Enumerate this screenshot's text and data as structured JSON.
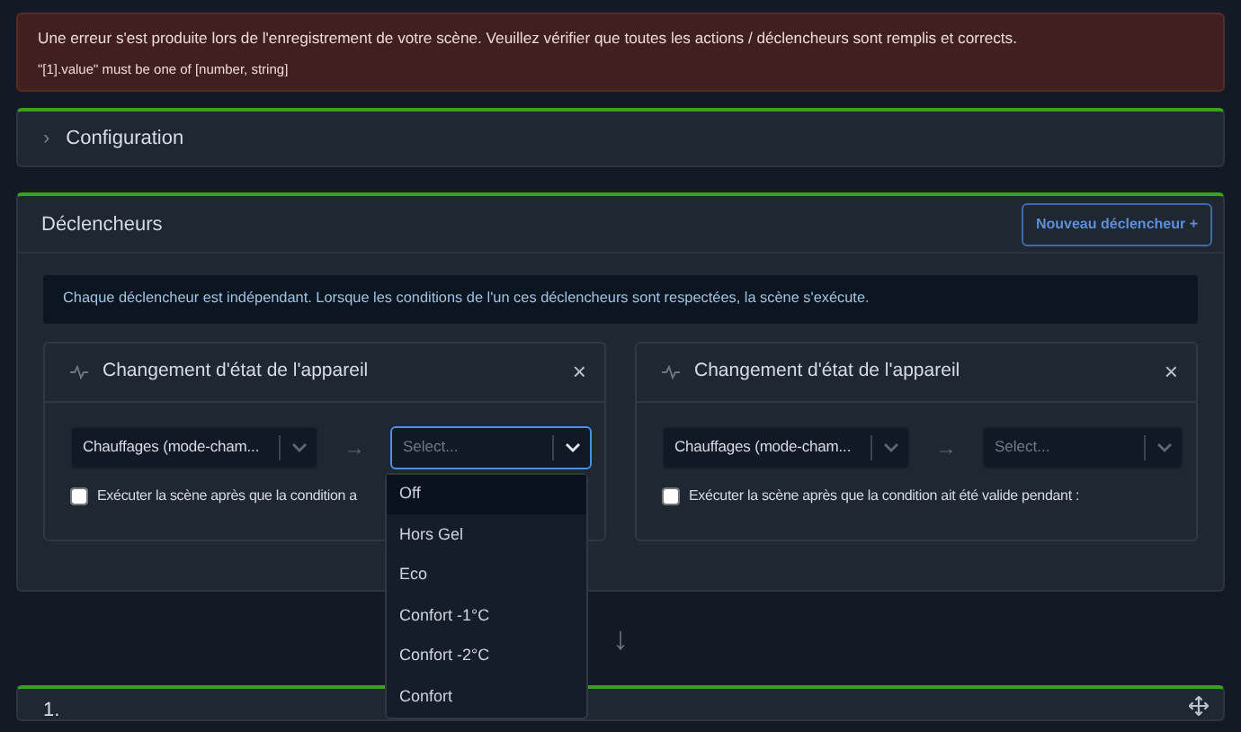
{
  "error": {
    "message": "Une erreur s'est produite lors de l'enregistrement de votre scène. Veuillez vérifier que toutes les actions / déclencheurs sont remplis et corrects.",
    "detail": "\"[1].value\" must be one of [number, string]"
  },
  "configuration": {
    "title": "Configuration",
    "chevron": "›"
  },
  "triggers_section": {
    "title": "Déclencheurs",
    "new_button": "Nouveau déclencheur +",
    "info": "Chaque déclencheur est indépendant. Lorsque les conditions de l'un ces déclencheurs sont respectées, la scène s'exécute.",
    "triggers": [
      {
        "title": "Changement d'état de l'appareil",
        "close": "×",
        "device": "Chauffages (mode-cham...",
        "arrow": "→",
        "state_placeholder": "Select...",
        "focused": true,
        "delay_checked": false,
        "delay_label": "Exécuter la scène après que la condition a",
        "options": [
          {
            "label": "Off",
            "selected": true
          },
          {
            "label": "Hors Gel",
            "selected": false
          },
          {
            "label": "Eco",
            "selected": false
          },
          {
            "label": "Confort -1°C",
            "selected": false
          },
          {
            "label": "Confort -2°C",
            "selected": false
          },
          {
            "label": "Confort",
            "selected": false
          }
        ]
      },
      {
        "title": "Changement d'état de l'appareil",
        "close": "×",
        "device": "Chauffages (mode-cham...",
        "arrow": "→",
        "state_placeholder": "Select...",
        "focused": false,
        "delay_checked": false,
        "delay_label": "Exécuter la scène après que la condition ait été valide pendant :"
      }
    ]
  },
  "flow_arrow": "↓",
  "action_step": {
    "number": "1."
  }
}
